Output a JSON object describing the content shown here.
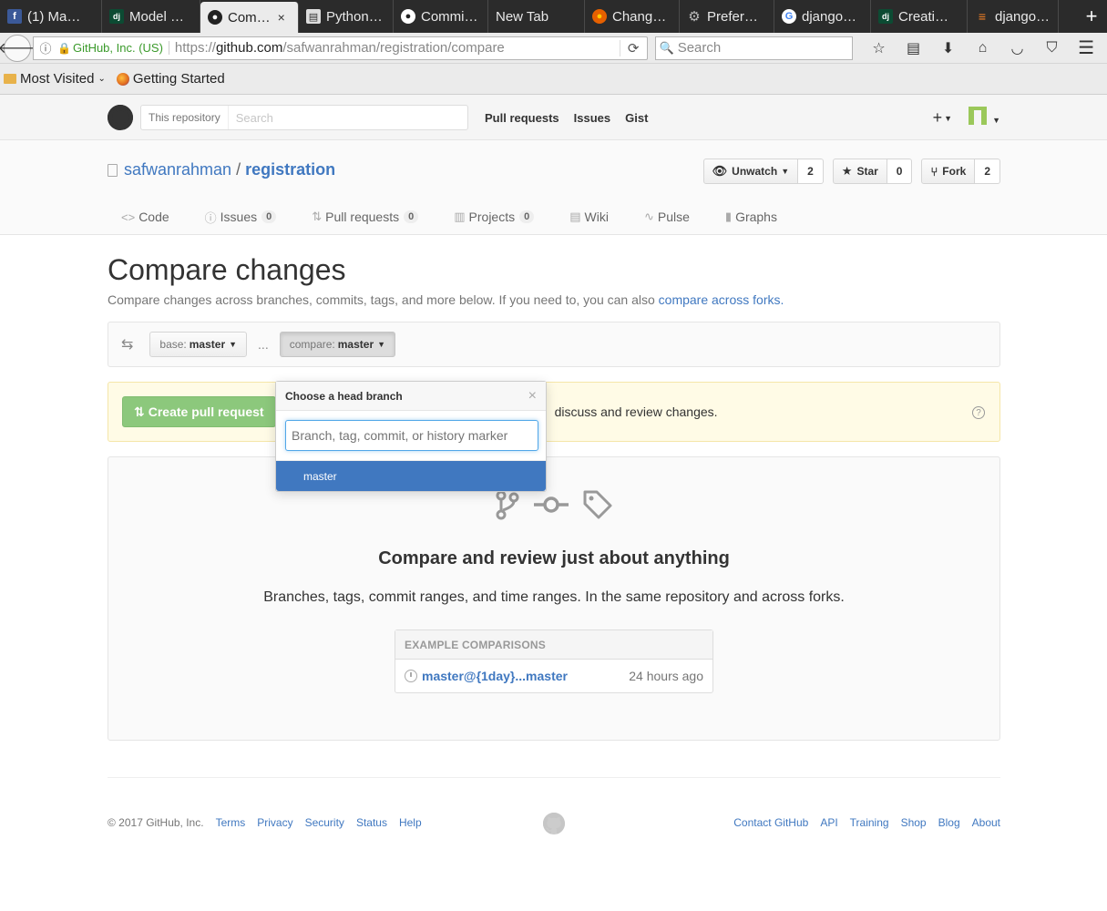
{
  "browser": {
    "tabs": [
      {
        "label": "(1) Ma…",
        "icon": "facebook-icon",
        "icon_color": "#3b5998",
        "glyph": "f"
      },
      {
        "label": "Model …",
        "icon": "django-icon",
        "icon_color": "#0c4b33",
        "glyph": "dj"
      },
      {
        "label": "Com…",
        "icon": "github-icon",
        "icon_color": "#222222",
        "glyph": "●",
        "active": true
      },
      {
        "label": "Python…",
        "icon": "document-icon",
        "icon_color": "#dddddd",
        "glyph": "▤"
      },
      {
        "label": "Commi…",
        "icon": "github-icon",
        "icon_color": "#222222",
        "glyph": "●"
      },
      {
        "label": "New Tab",
        "icon": "",
        "icon_color": "",
        "glyph": ""
      },
      {
        "label": "Chang…",
        "icon": "firefox-icon",
        "icon_color": "#e66000",
        "glyph": "●"
      },
      {
        "label": "Prefer…",
        "icon": "gear-icon",
        "icon_color": "#666666",
        "glyph": "⚙"
      },
      {
        "label": "django…",
        "icon": "google-icon",
        "icon_color": "#ffffff",
        "glyph": "G"
      },
      {
        "label": "Creati…",
        "icon": "django-icon",
        "icon_color": "#0c4b33",
        "glyph": "dj"
      },
      {
        "label": "django…",
        "icon": "stackoverflow-icon",
        "icon_color": "#f48024",
        "glyph": "≡"
      }
    ],
    "tab_close": "×",
    "new_tab": "+",
    "identity": "GitHub, Inc. (US)",
    "url_proto": "https://",
    "url_host": "github.com",
    "url_path": "/safwanrahman/registration/compare",
    "search_placeholder": "Search",
    "bookmarks": {
      "most_visited": "Most Visited",
      "getting_started": "Getting Started"
    }
  },
  "github": {
    "search_scope": "This repository",
    "search_placeholder": "Search",
    "nav": {
      "pull_requests": "Pull requests",
      "issues": "Issues",
      "gist": "Gist"
    },
    "plus": "+"
  },
  "repo": {
    "owner": "safwanrahman",
    "separator": "/",
    "name": "registration",
    "unwatch_label": "Unwatch",
    "unwatch_count": "2",
    "star_label": "Star",
    "star_count": "0",
    "fork_label": "Fork",
    "fork_count": "2",
    "tabs": {
      "code": "Code",
      "issues": "Issues",
      "issues_count": "0",
      "pulls": "Pull requests",
      "pulls_count": "0",
      "projects": "Projects",
      "projects_count": "0",
      "wiki": "Wiki",
      "pulse": "Pulse",
      "graphs": "Graphs"
    }
  },
  "compare": {
    "title": "Compare changes",
    "description": "Compare changes across branches, commits, tags, and more below. If you need to, you can also ",
    "forks_link": "compare across forks.",
    "base_key": "base:",
    "base_value": "master",
    "dots": "...",
    "compare_key": "compare:",
    "compare_value": "master",
    "create_pr": "Create pull request",
    "flash_text": "discuss and review changes.",
    "help": "?"
  },
  "dropdown": {
    "title": "Choose a head branch",
    "close": "×",
    "filter_placeholder": "Branch, tag, commit, or history marker",
    "items": [
      "master"
    ]
  },
  "blankslate": {
    "title": "Compare and review just about anything",
    "description": "Branches, tags, commit ranges, and time ranges. In the same repository and across forks.",
    "examples_header": "EXAMPLE COMPARISONS",
    "example_link": "master@{1day}...master",
    "example_time": "24 hours ago"
  },
  "footer": {
    "copyright": "© 2017 GitHub, Inc.",
    "left_links": [
      "Terms",
      "Privacy",
      "Security",
      "Status",
      "Help"
    ],
    "right_links": [
      "Contact GitHub",
      "API",
      "Training",
      "Shop",
      "Blog",
      "About"
    ]
  }
}
